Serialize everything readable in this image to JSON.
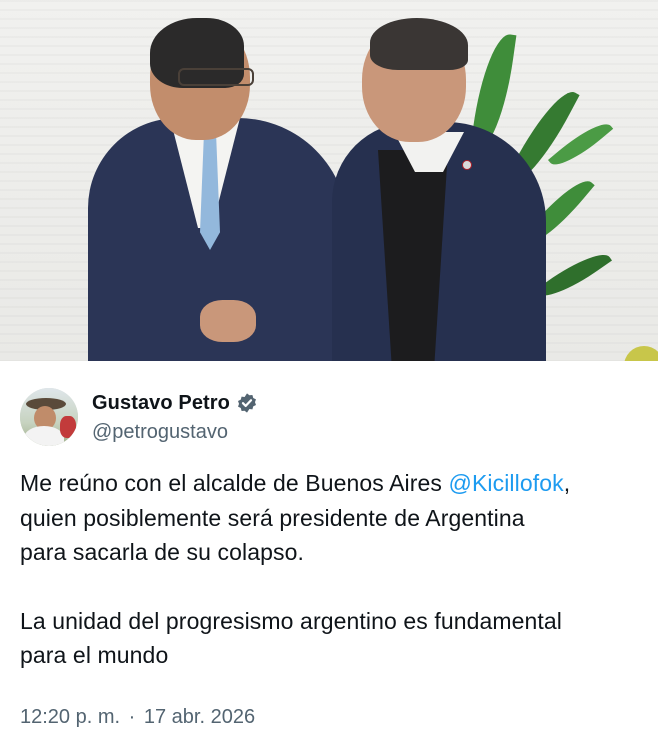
{
  "photo": {
    "icon": "photo-of-two-men-smiling"
  },
  "author": {
    "display_name": "Gustavo Petro",
    "handle": "@petrogustavo",
    "verified": true,
    "verified_color": "#536471"
  },
  "tweet": {
    "line1_prefix": "Me reúno con el alcalde de Buenos Aires ",
    "mention": "@Kicillofok",
    "line1_suffix": ",",
    "line2": "quien posiblemente será presidente de Argentina",
    "line3": "para sacarla de su colapso.",
    "para2_line1": "La unidad del progresismo argentino es fundamental",
    "para2_line2": "para el mundo"
  },
  "meta": {
    "time": "12:20 p. m.",
    "separator": "·",
    "date": "17 abr. 2026"
  },
  "colors": {
    "text": "#0f1419",
    "secondary": "#536471",
    "link": "#1d9bf0"
  }
}
